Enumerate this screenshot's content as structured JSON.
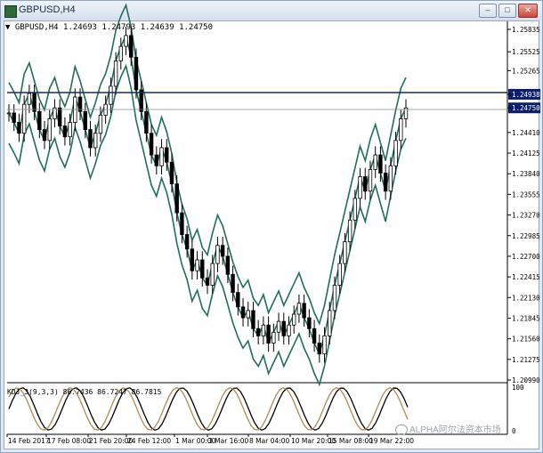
{
  "window": {
    "title": "GBPUSD,H4",
    "buttons": [
      "–",
      "□",
      "✕"
    ]
  },
  "chart": {
    "header": "▼ GBPUSD,H4  1.24693 1.24793 1.24639 1.24750",
    "price_labels": [
      "1.25835",
      "1.25525",
      "1.25265",
      "1.24938",
      "1.24750",
      "1.24410",
      "1.24125",
      "1.23840",
      "1.23555",
      "1.23270",
      "1.22985",
      "1.22700",
      "1.22415",
      "1.22130",
      "1.21845",
      "1.21560",
      "1.21275",
      "1.20990"
    ],
    "highlighted_prices": {
      "resistance": "1.24938",
      "current": "1.24750"
    },
    "time_labels": [
      "14 Feb 2017",
      "17 Feb 08:00",
      "21 Feb 20:00",
      "24 Feb 12:00",
      "1 Mar 00:00",
      "3 Mar 16:00",
      "8 Mar 04:00",
      "10 Mar 20:00",
      "15 Mar 08:00",
      "19 Mar 22:00"
    ],
    "indicator_label": "KDJ_3(9,3,3) 86.7436 86.7247 86.7815",
    "indicator_levels": [
      "100",
      "0"
    ],
    "watermark": "ALPHA阿尔法资本市场",
    "colors": {
      "band": "#1f6e5c",
      "candle": "#000000",
      "line_resistance": "#1a2a6a",
      "k_line": "#000000",
      "d_line": "#b08a50",
      "highlight_bg": "#0b1f6b"
    }
  }
}
